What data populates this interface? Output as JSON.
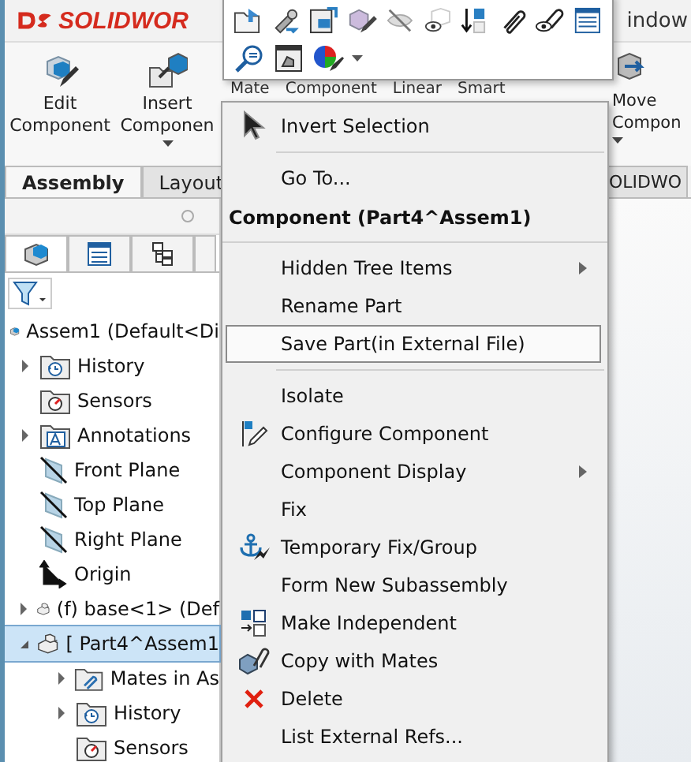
{
  "title_bar": {
    "logo": "SOLIDWOR",
    "menu_right": "indow"
  },
  "ribbon": {
    "buttons": [
      {
        "label": "Edit Component",
        "dropdown": false
      },
      {
        "label": "Insert Componen",
        "dropdown": true
      }
    ],
    "covered_labels": [
      "Mate",
      "Component",
      "Linear",
      "Smart"
    ],
    "right_button": {
      "label": "Move Compon",
      "dropdown": true
    }
  },
  "tabs": [
    {
      "label": "Assembly",
      "selected": true
    },
    {
      "label": "Layout",
      "selected": false
    }
  ],
  "right_tab": "OLIDWO",
  "tree": [
    {
      "label": "Assem1  (Default<Di",
      "children": [
        {
          "label": "History",
          "kind": "history",
          "has_children": true,
          "selected": false
        },
        {
          "label": "Sensors",
          "kind": "sensors",
          "has_children": false,
          "selected": false
        },
        {
          "label": "Annotations",
          "kind": "annotations",
          "has_children": true,
          "selected": false
        },
        {
          "label": "Front Plane",
          "kind": "plane",
          "has_children": false,
          "selected": false
        },
        {
          "label": "Top Plane",
          "kind": "plane",
          "has_children": false,
          "selected": false
        },
        {
          "label": "Right Plane",
          "kind": "plane",
          "has_children": false,
          "selected": false
        },
        {
          "label": "Origin",
          "kind": "origin",
          "has_children": false,
          "selected": false
        },
        {
          "label": "(f) base<1>  (Def",
          "kind": "part",
          "has_children": true,
          "expanded": false,
          "selected": false
        },
        {
          "label": "[ Part4^Assem1",
          "kind": "part",
          "has_children": true,
          "expanded": true,
          "selected": true,
          "children": [
            {
              "label": "Mates in As",
              "kind": "mates",
              "has_children": true,
              "selected": false
            },
            {
              "label": "History",
              "kind": "history",
              "has_children": true,
              "selected": false
            },
            {
              "label": "Sensors",
              "kind": "sensors",
              "has_children": false,
              "selected": false
            }
          ]
        }
      ]
    }
  ],
  "context_menu": [
    {
      "kind": "item",
      "label": "Invert Selection",
      "submenu": false,
      "selected": false
    },
    {
      "kind": "separator"
    },
    {
      "kind": "item",
      "label": "Go To...",
      "submenu": false,
      "selected": false
    },
    {
      "kind": "header",
      "label": "Component (Part4^Assem1)"
    },
    {
      "kind": "item",
      "label": "Hidden Tree Items",
      "submenu": true,
      "selected": false
    },
    {
      "kind": "item",
      "label": "Rename Part",
      "submenu": false,
      "selected": false
    },
    {
      "kind": "item",
      "label": "Save Part(in External File)",
      "submenu": false,
      "selected": true
    },
    {
      "kind": "separator"
    },
    {
      "kind": "item",
      "label": "Isolate",
      "submenu": false,
      "selected": false
    },
    {
      "kind": "item",
      "label": "Configure Component",
      "submenu": false,
      "selected": false
    },
    {
      "kind": "item",
      "label": "Component Display",
      "submenu": true,
      "selected": false
    },
    {
      "kind": "item",
      "label": "Fix",
      "submenu": false,
      "selected": false
    },
    {
      "kind": "item",
      "label": "Temporary Fix/Group",
      "submenu": false,
      "selected": false
    },
    {
      "kind": "item",
      "label": "Form New Subassembly",
      "submenu": false,
      "selected": false
    },
    {
      "kind": "item",
      "label": "Make Independent",
      "submenu": false,
      "selected": false
    },
    {
      "kind": "item",
      "label": "Copy with Mates",
      "submenu": false,
      "selected": false
    },
    {
      "kind": "item",
      "label": "Delete",
      "submenu": false,
      "selected": false
    },
    {
      "kind": "item",
      "label": "List External Refs...",
      "submenu": false,
      "selected": false
    }
  ]
}
